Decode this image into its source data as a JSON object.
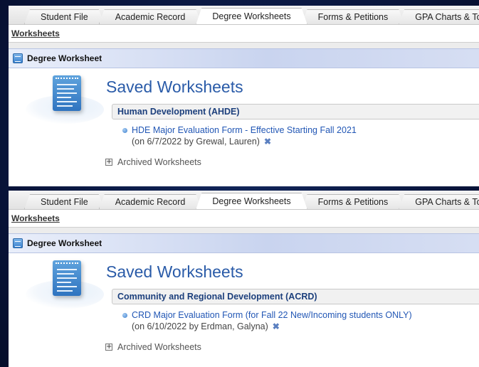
{
  "panels": [
    {
      "tabs": [
        "Student File",
        "Academic Record",
        "Degree Worksheets",
        "Forms & Petitions",
        "GPA Charts & Tools"
      ],
      "active_tab": "Degree Worksheets",
      "subnav_link": "Worksheets",
      "section_title": "Degree Worksheet",
      "heading": "Saved Worksheets",
      "group_label": "Human Development (AHDE)",
      "worksheet_link": "HDE Major Evaluation Form - Effective Starting Fall 2021",
      "worksheet_meta": "(on 6/7/2022 by Grewal, Lauren)",
      "delete_glyph": "✖",
      "expand_glyph": "+",
      "archived_label": "Archived Worksheets"
    },
    {
      "tabs": [
        "Student File",
        "Academic Record",
        "Degree Worksheets",
        "Forms & Petitions",
        "GPA Charts & Tools"
      ],
      "active_tab": "Degree Worksheets",
      "subnav_link": "Worksheets",
      "section_title": "Degree Worksheet",
      "heading": "Saved Worksheets",
      "group_label": "Community and Regional Development (ACRD)",
      "worksheet_link": "CRD Major Evaluation Form (for Fall 22 New/Incoming students ONLY)",
      "worksheet_meta": "(on 6/10/2022 by Erdman, Galyna)",
      "delete_glyph": "✖",
      "expand_glyph": "+",
      "archived_label": "Archived Worksheets"
    }
  ],
  "colors": {
    "heading": "#2a5ba8",
    "link": "#2257b5",
    "group_label": "#1c3f7c",
    "background": "#0a1740"
  }
}
